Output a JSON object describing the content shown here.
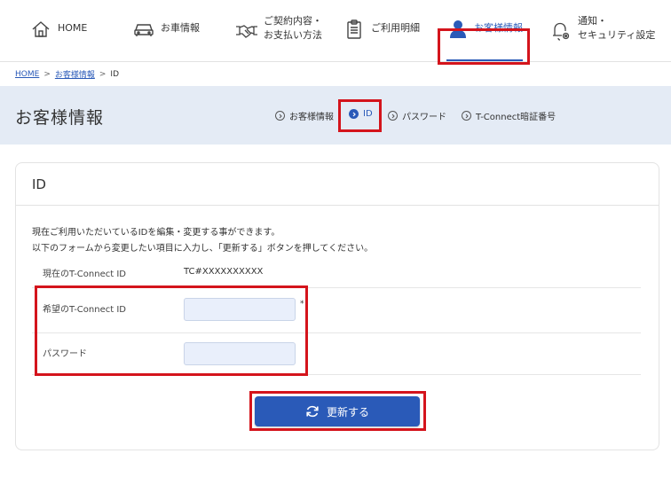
{
  "nav": {
    "home": "HOME",
    "vehicle": "お車情報",
    "contract_line1": "ご契約内容・",
    "contract_line2": "お支払い方法",
    "usage": "ご利用明細",
    "customer": "お客様情報",
    "notify_line1": "通知・",
    "notify_line2": "セキュリティ設定"
  },
  "breadcrumb": {
    "home": "HOME",
    "customer": "お客様情報",
    "current": "ID",
    "sep": ">"
  },
  "page": {
    "title": "お客様情報"
  },
  "subnav": {
    "items": [
      "お客様情報",
      "ID",
      "パスワード",
      "T-Connect暗証番号"
    ],
    "active_index": 1
  },
  "card": {
    "title": "ID",
    "desc_line1": "現在ご利用いただいているIDを編集・変更する事ができます。",
    "desc_line2": "以下のフォームから変更したい項目に入力し、「更新する」ボタンを押してください。",
    "current_id_label": "現在のT-Connect ID",
    "current_id_value": "TC#XXXXXXXXXX",
    "desired_id_label": "希望のT-Connect ID",
    "desired_id_value": "",
    "required_mark": "*",
    "password_label": "パスワード",
    "password_value": ""
  },
  "actions": {
    "update_label": "更新する"
  },
  "colors": {
    "accent": "#2a5ab8",
    "band": "#e4ebf5",
    "highlight": "#d4141c",
    "input_bg": "#e9effb"
  },
  "icons": {
    "home": "home-icon",
    "vehicle": "car-icon",
    "contract": "handshake-icon",
    "usage": "clipboard-icon",
    "customer": "user-icon",
    "notify": "bell-gear-icon",
    "update": "refresh-icon"
  }
}
